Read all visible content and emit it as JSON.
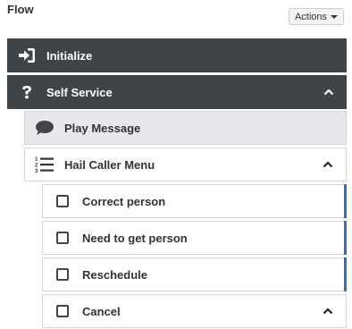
{
  "header": {
    "title": "Flow",
    "actions_label": "Actions"
  },
  "colors": {
    "dark_row": "#3f4449",
    "light_row": "#e6e8ec",
    "accent": "#2f6fc0"
  },
  "tree": {
    "initialize": {
      "label": "Initialize",
      "icon": "sign-in-icon"
    },
    "self_service": {
      "label": "Self Service",
      "icon": "question-icon",
      "expanded": true
    },
    "play_message": {
      "label": "Play Message",
      "icon": "speech-bubble-icon"
    },
    "hail_caller_menu": {
      "label": "Hail Caller Menu",
      "icon": "numbered-list-icon",
      "expanded": true
    },
    "options": [
      {
        "label": "Correct person",
        "checked": false
      },
      {
        "label": "Need to get person",
        "checked": false
      },
      {
        "label": "Reschedule",
        "checked": false
      },
      {
        "label": "Cancel",
        "checked": false,
        "expanded": true
      }
    ]
  }
}
